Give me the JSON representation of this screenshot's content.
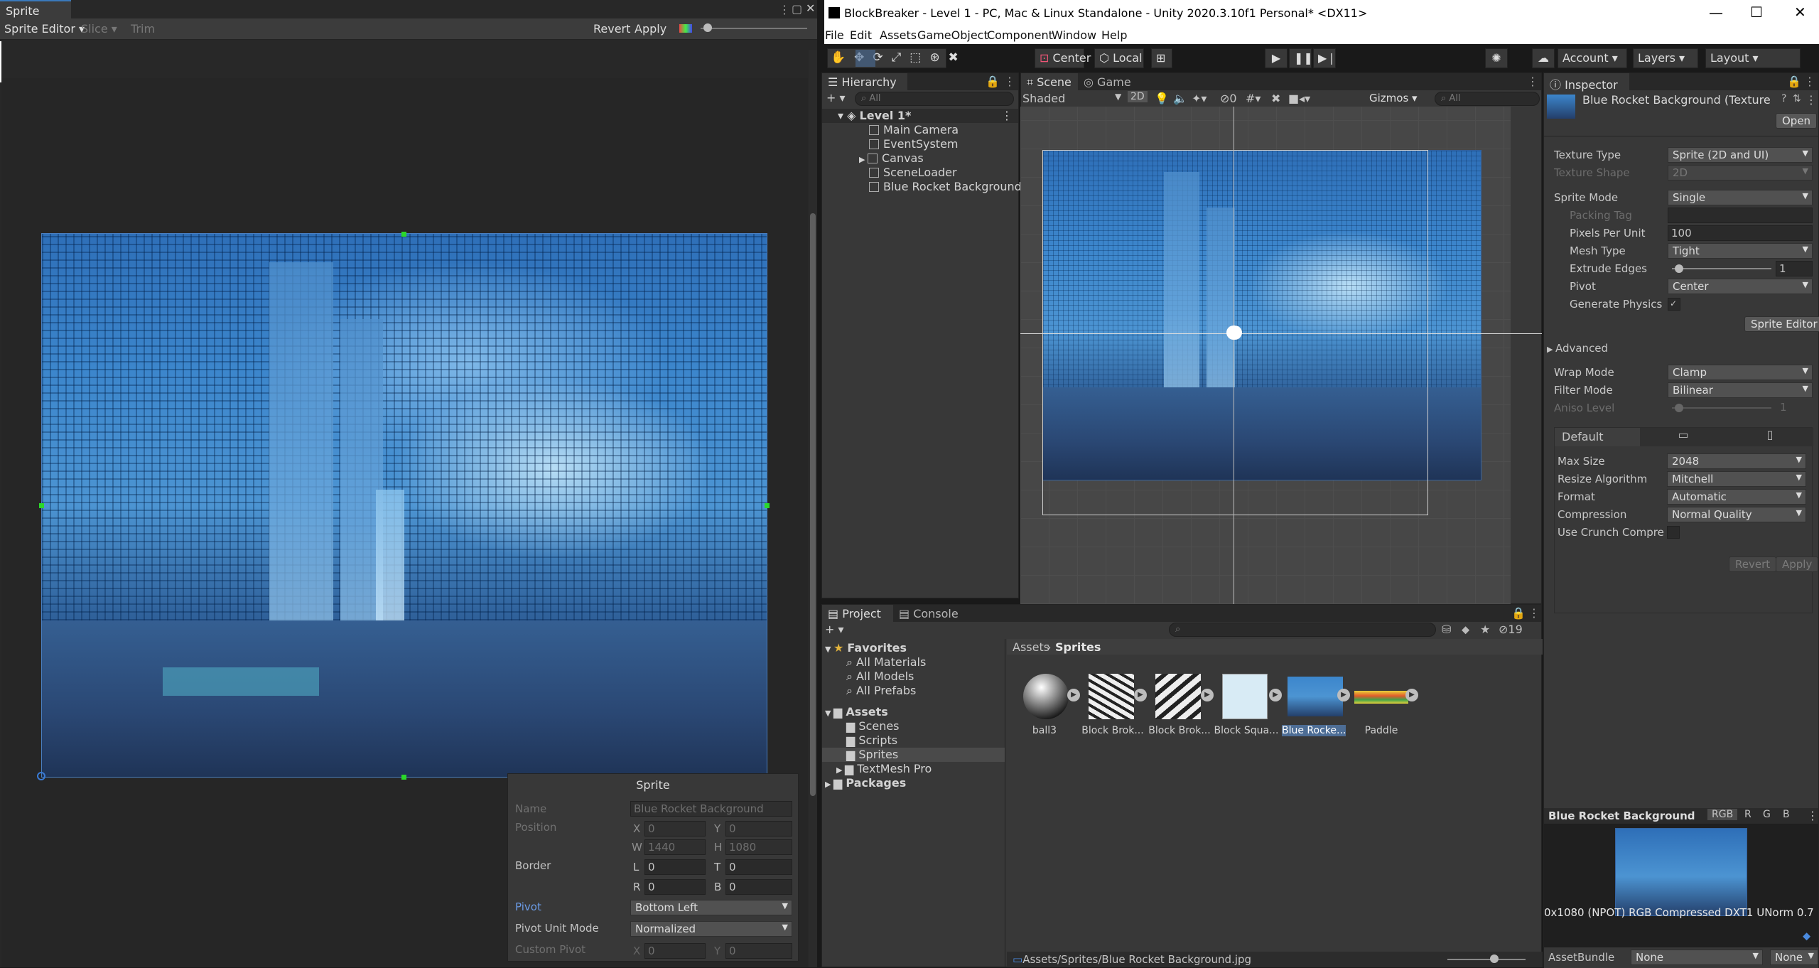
{
  "sprite_editor": {
    "tab_title": "Sprite Editor",
    "toolbar": {
      "mode": "Sprite Editor",
      "slice": "Slice",
      "trim": "Trim",
      "revert": "Revert",
      "apply": "Apply"
    },
    "panel": {
      "title": "Sprite",
      "name_label": "Name",
      "name_value": "Blue Rocket Background",
      "position_label": "Position",
      "x": "0",
      "y": "0",
      "w": "1440",
      "h": "1080",
      "border_label": "Border",
      "l": "0",
      "t": "0",
      "r": "0",
      "b": "0",
      "pivot_label": "Pivot",
      "pivot_value": "Bottom Left",
      "pivot_unit_label": "Pivot Unit Mode",
      "pivot_unit_value": "Normalized",
      "custom_pivot_label": "Custom Pivot",
      "cx": "0",
      "cy": "0"
    }
  },
  "window": {
    "title": "BlockBreaker - Level 1 - PC, Mac & Linux Standalone - Unity 2020.3.10f1 Personal* <DX11>"
  },
  "menu": [
    "File",
    "Edit",
    "Assets",
    "GameObject",
    "Component",
    "Window",
    "Help"
  ],
  "toolbar": {
    "center": "Center",
    "local": "Local",
    "account": "Account",
    "layers": "Layers",
    "layout": "Layout"
  },
  "hierarchy": {
    "tab": "Hierarchy",
    "search": "All",
    "scene": "Level 1*",
    "items": [
      "Main Camera",
      "EventSystem",
      "Canvas",
      "SceneLoader",
      "Blue Rocket Background"
    ]
  },
  "scene": {
    "tab_scene": "Scene",
    "tab_game": "Game",
    "shading": "Shaded",
    "mode2d": "2D",
    "hidden_count": "0",
    "gizmos": "Gizmos",
    "search": "All"
  },
  "project": {
    "tab_project": "Project",
    "tab_console": "Console",
    "hidden_count": "19",
    "favorites": "Favorites",
    "fav_items": [
      "All Materials",
      "All Models",
      "All Prefabs"
    ],
    "assets": "Assets",
    "asset_folders": [
      "Scenes",
      "Scripts",
      "Sprites",
      "TextMesh Pro"
    ],
    "packages": "Packages",
    "breadcrumb_root": "Assets",
    "breadcrumb_current": "Sprites",
    "files": [
      "ball3",
      "Block Brok...",
      "Block Brok...",
      "Block Squa...",
      "Blue Rocke...",
      "Paddle"
    ],
    "path": "Assets/Sprites/Blue Rocket Background.jpg"
  },
  "inspector": {
    "tab": "Inspector",
    "asset_title": "Blue Rocket Background (Texture",
    "open": "Open",
    "rows": [
      {
        "k": "Texture Type",
        "v": "Sprite (2D and UI)"
      },
      {
        "k": "Texture Shape",
        "v": "2D"
      },
      {
        "k": "Sprite Mode",
        "v": "Single"
      },
      {
        "k": "Packing Tag",
        "v": ""
      },
      {
        "k": "Pixels Per Unit",
        "v": "100"
      },
      {
        "k": "Mesh Type",
        "v": "Tight"
      },
      {
        "k": "Extrude Edges",
        "v": "1"
      },
      {
        "k": "Pivot",
        "v": "Center"
      },
      {
        "k": "Generate Physics",
        "v": "✓"
      }
    ],
    "sprite_editor_btn": "Sprite Editor",
    "advanced": "Advanced",
    "rows2": [
      {
        "k": "Wrap Mode",
        "v": "Clamp"
      },
      {
        "k": "Filter Mode",
        "v": "Bilinear"
      },
      {
        "k": "Aniso Level",
        "v": "1"
      }
    ],
    "platform_tab": "Default",
    "rows3": [
      {
        "k": "Max Size",
        "v": "2048"
      },
      {
        "k": "Resize Algorithm",
        "v": "Mitchell"
      },
      {
        "k": "Format",
        "v": "Automatic"
      },
      {
        "k": "Compression",
        "v": "Normal Quality"
      },
      {
        "k": "Use Crunch Compres",
        "v": ""
      }
    ],
    "revert": "Revert",
    "apply": "Apply",
    "preview_title": "Blue Rocket Background",
    "channels": [
      "RGB",
      "R",
      "G",
      "B"
    ],
    "preview_info": "0x1080 (NPOT)  RGB Compressed DXT1 UNorm  0.7",
    "assetbundle_label": "AssetBundle",
    "assetbundle_value": "None",
    "variant_value": "None"
  }
}
